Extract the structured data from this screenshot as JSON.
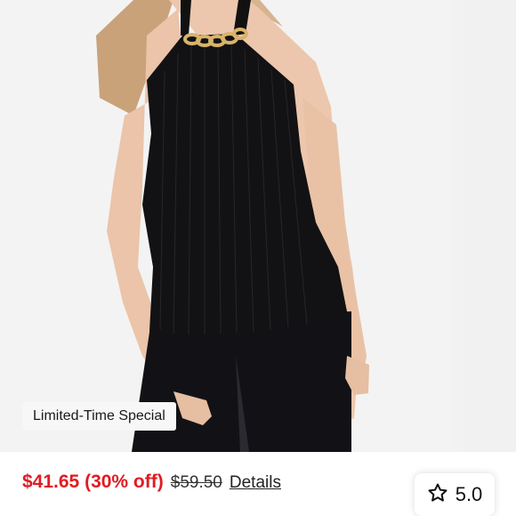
{
  "badge": {
    "label": "Limited-Time Special"
  },
  "price": {
    "sale": "$41.65",
    "discount": "(30% off)",
    "original": "$59.50",
    "details_label": "Details",
    "sale_color": "#e11b22"
  },
  "rating": {
    "icon": "star-outline-icon",
    "value": "5.0"
  }
}
